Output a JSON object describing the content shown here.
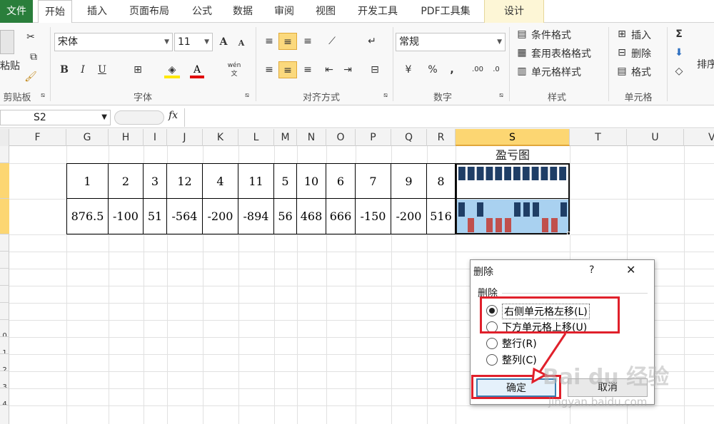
{
  "tabs": [
    "文件",
    "开始",
    "插入",
    "页面布局",
    "公式",
    "数据",
    "审阅",
    "视图",
    "开发工具",
    "PDF工具集",
    "设计"
  ],
  "ribbon": {
    "clipboard": {
      "paste": "粘贴",
      "label": "剪贴板"
    },
    "font": {
      "name": "宋体",
      "size": "11",
      "label": "字体",
      "bold": "B",
      "italic": "I",
      "underline": "U",
      "grow": "A",
      "shrink": "A",
      "color_a": "A",
      "wen": "wén"
    },
    "align": {
      "label": "对齐方式"
    },
    "number": {
      "format": "常规",
      "percent": "%",
      "comma": ",",
      "label": "数字"
    },
    "styles": {
      "cond": "条件格式",
      "table": "套用表格格式",
      "cell": "单元格样式",
      "label": "样式"
    },
    "cells": {
      "insert": "插入",
      "delete": "删除",
      "format": "格式",
      "label": "单元格"
    },
    "editing": {
      "sigma": "Σ",
      "sort": "排序"
    }
  },
  "formula_bar": {
    "name_box": "S2",
    "fx": "fx",
    "content": ""
  },
  "columns": [
    "F",
    "G",
    "H",
    "I",
    "J",
    "K",
    "L",
    "M",
    "N",
    "O",
    "P",
    "Q",
    "R",
    "S",
    "T",
    "U",
    "V"
  ],
  "rows": [
    "",
    "",
    "",
    "",
    "",
    "",
    "",
    "",
    "",
    "",
    "",
    "",
    "",
    "",
    "",
    "0",
    "1",
    "2",
    "3",
    "4"
  ],
  "sheet": {
    "title": "盈亏图",
    "row1": [
      "1",
      "2",
      "3",
      "12",
      "4",
      "11",
      "5",
      "10",
      "6",
      "7",
      "9",
      "8"
    ],
    "row2": [
      "876.5",
      "-100",
      "51",
      "-564",
      "-200",
      "-894",
      "56",
      "468",
      "666",
      "-150",
      "-200",
      "516"
    ],
    "sparkline_colors": {
      "positive": "#1f3e66",
      "negative": "#c0504d",
      "fill": "#a9d1f0"
    }
  },
  "dialog": {
    "title": "删除",
    "help": "?",
    "close": "✕",
    "group": "删除",
    "options": [
      {
        "label": "右侧单元格左移(L)",
        "selected": true
      },
      {
        "label": "下方单元格上移(U)",
        "selected": false
      },
      {
        "label": "整行(R)",
        "selected": false
      },
      {
        "label": "整列(C)",
        "selected": false
      }
    ],
    "ok": "确定",
    "cancel": "取消"
  },
  "watermark": {
    "brand": "Bai du 经验",
    "url": "jingyan.baidu.com"
  }
}
